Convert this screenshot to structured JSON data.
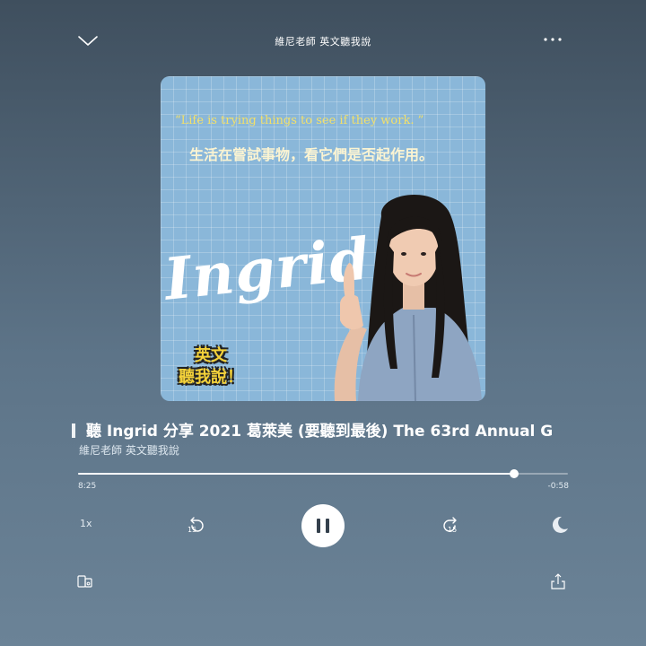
{
  "header": {
    "title": "維尼老師 英文聽我說",
    "collapse_icon": "chevron-down-icon",
    "more_icon": "more-dots-icon"
  },
  "artwork": {
    "quote_en": "“Life is trying things to see if they work. ”",
    "quote_zh": "生活在嘗試事物，看它們是否起作用。",
    "name_script": "Ingrid",
    "badge_line1": "英文",
    "badge_line2": "聽我說！"
  },
  "track": {
    "title": "聽 Ingrid 分享 2021 葛萊美 (要聽到最後) The 63rd Annual G",
    "artist": "維尼老師 英文聽我說"
  },
  "progress": {
    "elapsed": "8:25",
    "remaining": "-0:58",
    "fraction": 0.89
  },
  "controls": {
    "speed": "1x",
    "skip_back_seconds": "15",
    "skip_forward_seconds": "15",
    "play_state": "pause-icon",
    "sleep_icon": "moon-icon"
  },
  "footer": {
    "devices_icon": "devices-icon",
    "share_icon": "share-icon"
  },
  "colors": {
    "background_top": "#3f4f5e",
    "background_bottom": "#6b8397",
    "art_bg": "#8ab7d9",
    "quote_yellow": "#f3e06a",
    "badge_yellow": "#f4d23a"
  }
}
